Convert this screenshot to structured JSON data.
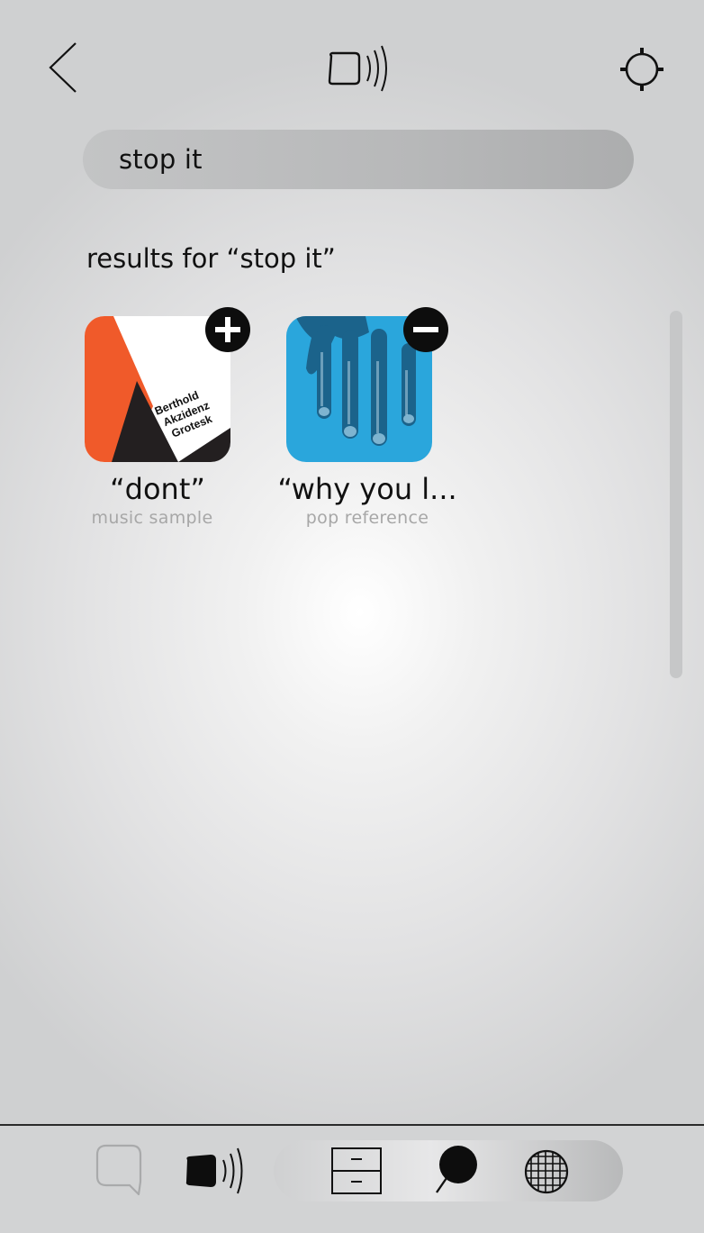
{
  "header": {
    "back_icon": "chevron-left-icon",
    "center_icon": "speaker-sound-icon",
    "settings_icon": "gear-icon"
  },
  "search": {
    "query": "stop it"
  },
  "results": {
    "heading": "results for “stop it”",
    "items": [
      {
        "title": "“dont”",
        "subtitle": "music sample",
        "artwork_text": [
          "Berthold",
          "Akzidenz",
          "Grotesk"
        ],
        "badge_icon": "plus-circle-icon"
      },
      {
        "title": "“why you l...",
        "subtitle": "pop reference",
        "artwork": "blue-hand-image",
        "badge_icon": "minus-circle-icon"
      }
    ]
  },
  "bottom_nav": {
    "items": [
      "chat-bubble-icon",
      "speaker-sound-icon",
      "archive-drawer-icon",
      "search-magnifier-icon",
      "globe-grid-icon"
    ]
  },
  "colors": {
    "accent_orange": "#f05a2a",
    "accent_blue": "#2aa6dc",
    "search_bg": "#b7b8b9",
    "muted_text": "#a7a7a7"
  }
}
